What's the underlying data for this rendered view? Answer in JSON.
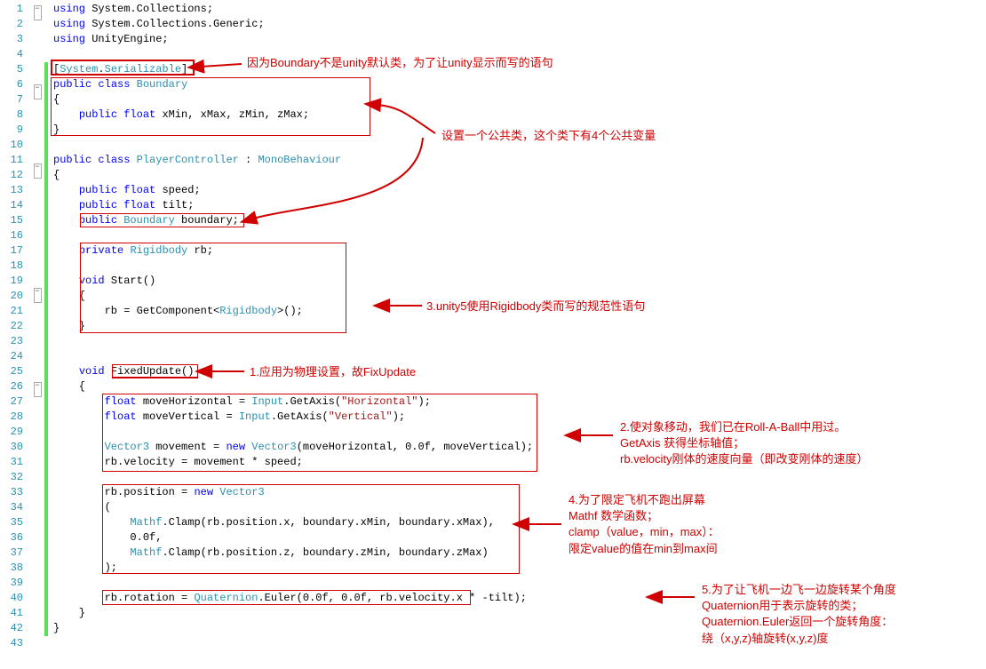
{
  "lines": [
    {
      "n": 1,
      "fold": "minus",
      "change": false,
      "html": "<span class='kw'>using</span> System.Collections;"
    },
    {
      "n": 2,
      "fold": "",
      "change": false,
      "html": "<span class='kw'>using</span> System.Collections.Generic;"
    },
    {
      "n": 3,
      "fold": "",
      "change": false,
      "html": "<span class='kw'>using</span> UnityEngine;"
    },
    {
      "n": 4,
      "fold": "",
      "change": false,
      "html": ""
    },
    {
      "n": 5,
      "fold": "",
      "change": true,
      "html": "[<span class='type'>System</span>.<span class='type'>Serializable</span>]"
    },
    {
      "n": 6,
      "fold": "minus",
      "change": true,
      "html": "<span class='kw'>public</span> <span class='kw'>class</span> <span class='type'>Boundary</span>"
    },
    {
      "n": 7,
      "fold": "",
      "change": true,
      "html": "{"
    },
    {
      "n": 8,
      "fold": "",
      "change": true,
      "html": "    <span class='kw'>public</span> <span class='kw'>float</span> xMin, xMax, zMin, zMax;"
    },
    {
      "n": 9,
      "fold": "",
      "change": true,
      "html": "}"
    },
    {
      "n": 10,
      "fold": "",
      "change": true,
      "html": ""
    },
    {
      "n": 11,
      "fold": "minus",
      "change": true,
      "html": "<span class='kw'>public</span> <span class='kw'>class</span> <span class='type'>PlayerController</span> : <span class='type'>MonoBehaviour</span>"
    },
    {
      "n": 12,
      "fold": "",
      "change": true,
      "html": "{"
    },
    {
      "n": 13,
      "fold": "",
      "change": true,
      "html": "    <span class='kw'>public</span> <span class='kw'>float</span> speed;"
    },
    {
      "n": 14,
      "fold": "",
      "change": true,
      "html": "    <span class='kw'>public</span> <span class='kw'>float</span> tilt;"
    },
    {
      "n": 15,
      "fold": "",
      "change": true,
      "html": "    <span class='kw'>public</span> <span class='type'>Boundary</span> boundary;"
    },
    {
      "n": 16,
      "fold": "",
      "change": true,
      "html": ""
    },
    {
      "n": 17,
      "fold": "",
      "change": true,
      "html": "    <span class='kw'>private</span> <span class='type'>Rigidbody</span> rb;"
    },
    {
      "n": 18,
      "fold": "",
      "change": true,
      "html": ""
    },
    {
      "n": 19,
      "fold": "minus",
      "change": true,
      "html": "    <span class='kw'>void</span> Start()"
    },
    {
      "n": 20,
      "fold": "",
      "change": true,
      "html": "    {"
    },
    {
      "n": 21,
      "fold": "",
      "change": true,
      "html": "        rb = GetComponent&lt;<span class='type'>Rigidbody</span>&gt;();"
    },
    {
      "n": 22,
      "fold": "",
      "change": true,
      "html": "    }"
    },
    {
      "n": 23,
      "fold": "",
      "change": true,
      "html": ""
    },
    {
      "n": 24,
      "fold": "",
      "change": true,
      "html": ""
    },
    {
      "n": 25,
      "fold": "minus",
      "change": true,
      "html": "    <span class='kw'>void</span> FixedUpdate()"
    },
    {
      "n": 26,
      "fold": "",
      "change": true,
      "html": "    {"
    },
    {
      "n": 27,
      "fold": "",
      "change": true,
      "html": "        <span class='kw'>float</span> moveHorizontal = <span class='type'>Input</span>.GetAxis(<span class='str'>\"Horizontal\"</span>);"
    },
    {
      "n": 28,
      "fold": "",
      "change": true,
      "html": "        <span class='kw'>float</span> moveVertical = <span class='type'>Input</span>.GetAxis(<span class='str'>\"Vertical\"</span>);"
    },
    {
      "n": 29,
      "fold": "",
      "change": true,
      "html": ""
    },
    {
      "n": 30,
      "fold": "",
      "change": true,
      "html": "        <span class='type'>Vector3</span> movement = <span class='kw'>new</span> <span class='type'>Vector3</span>(moveHorizontal, 0.0f, moveVertical);"
    },
    {
      "n": 31,
      "fold": "",
      "change": true,
      "html": "        rb.velocity = movement * speed;"
    },
    {
      "n": 32,
      "fold": "",
      "change": true,
      "html": ""
    },
    {
      "n": 33,
      "fold": "",
      "change": true,
      "html": "        rb.position = <span class='kw'>new</span> <span class='type'>Vector3</span>"
    },
    {
      "n": 34,
      "fold": "",
      "change": true,
      "html": "        ("
    },
    {
      "n": 35,
      "fold": "",
      "change": true,
      "html": "            <span class='type'>Mathf</span>.Clamp(rb.position.x, boundary.xMin, boundary.xMax),"
    },
    {
      "n": 36,
      "fold": "",
      "change": true,
      "html": "            0.0f,"
    },
    {
      "n": 37,
      "fold": "",
      "change": true,
      "html": "            <span class='type'>Mathf</span>.Clamp(rb.position.z, boundary.zMin, boundary.zMax)"
    },
    {
      "n": 38,
      "fold": "",
      "change": true,
      "html": "        );"
    },
    {
      "n": 39,
      "fold": "",
      "change": true,
      "html": ""
    },
    {
      "n": 40,
      "fold": "",
      "change": true,
      "html": "        rb.rotation = <span class='type'>Quaternion</span>.Euler(0.0f, 0.0f, rb.velocity.x * -tilt);"
    },
    {
      "n": 41,
      "fold": "",
      "change": true,
      "html": "    }"
    },
    {
      "n": 42,
      "fold": "",
      "change": true,
      "html": "}"
    },
    {
      "n": 43,
      "fold": "",
      "change": false,
      "html": ""
    }
  ],
  "annotations": {
    "a1": "因为Boundary不是unity默认类，为了让unity显示而写的语句",
    "a2": "设置一个公共类，这个类下有4个公共变量",
    "a3": "3.unity5使用Rigidbody类而写的规范性语句",
    "a4": "1.应用为物理设置，故FixUpdate",
    "a5_l1": "2.使对象移动，我们已在Roll-A-Ball中用过。",
    "a5_l2": "GetAxis 获得坐标轴值；",
    "a5_l3": "rb.velocity刚体的速度向量（即改变刚体的速度）",
    "a6_l1": "4.为了限定飞机不跑出屏幕",
    "a6_l2": "Mathf 数学函数；",
    "a6_l3": "clamp（value，min，max）：",
    "a6_l4": "限定value的值在min到max间",
    "a7_l1": "5.为了让飞机一边飞一边旋转某个角度",
    "a7_l2": "Quaternion用于表示旋转的类；",
    "a7_l3": "Quaternion.Euler返回一个旋转角度：",
    "a7_l4": "绕（x,y,z)轴旋转(x,y,z)度"
  }
}
